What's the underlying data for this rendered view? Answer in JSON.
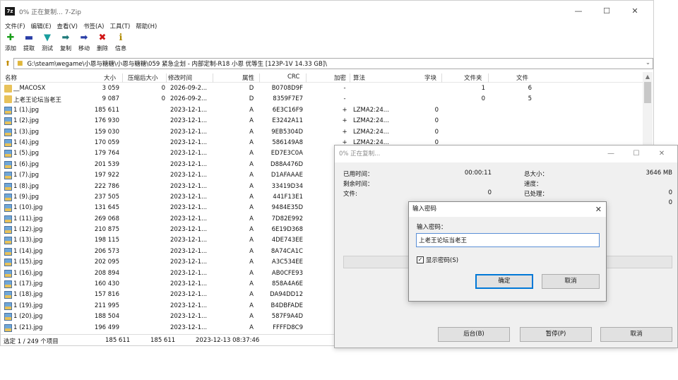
{
  "main_window": {
    "title": "0% 正在复制... 7-Zip",
    "app_icon_text": "7z",
    "controls": {
      "minimize": "—",
      "maximize": "☐",
      "close": "✕"
    }
  },
  "menu": [
    "文件(F)",
    "编辑(E)",
    "查看(V)",
    "书签(A)",
    "工具(T)",
    "帮助(H)"
  ],
  "toolbar": [
    {
      "label": "添加",
      "icon": "add-icon",
      "glyph": "✚",
      "color": "#1a9e1a"
    },
    {
      "label": "提取",
      "icon": "extract-icon",
      "glyph": "▬",
      "color": "#2a3ea6"
    },
    {
      "label": "测试",
      "icon": "test-icon",
      "glyph": "▼",
      "color": "#1a9e9e"
    },
    {
      "label": "复制",
      "icon": "copy-icon",
      "glyph": "➡",
      "color": "#1f7a7a"
    },
    {
      "label": "移动",
      "icon": "move-icon",
      "glyph": "➡",
      "color": "#2a3ea6"
    },
    {
      "label": "删除",
      "icon": "delete-icon",
      "glyph": "✖",
      "color": "#d01515"
    },
    {
      "label": "信息",
      "icon": "info-icon",
      "glyph": "ℹ",
      "color": "#b08a00"
    }
  ],
  "address": {
    "path": "G:\\steam\\wegame\\小恩与糖糖\\小恩与糖糖\\059 紧急企划 - 内部定制-R18 小恩 优等生 [123P-1V 14.33 GB]\\"
  },
  "columns": {
    "name": "名称",
    "size": "大小",
    "packed": "压缩后大小",
    "modified": "修改时间",
    "attributes": "属性",
    "crc": "CRC",
    "encrypted": "加密",
    "method": "算法",
    "block": "字块",
    "folders": "文件夹",
    "files": "文件"
  },
  "rows": [
    {
      "type": "folder",
      "name": "__MACOSX",
      "size": "3 059",
      "packed": "0",
      "modified": "2026-09-2...",
      "attr": "D",
      "crc": "B0708D9F",
      "enc": "-",
      "method": "",
      "block": "",
      "folders": "1",
      "files": "6"
    },
    {
      "type": "folder",
      "name": "上老王论坛当老王",
      "size": "9 087",
      "packed": "0",
      "modified": "2026-09-2...",
      "attr": "D",
      "crc": "8359F7E7",
      "enc": "-",
      "method": "",
      "block": "",
      "folders": "0",
      "files": "5"
    },
    {
      "type": "image",
      "name": "1 (1).jpg",
      "size": "185 611",
      "packed": "",
      "modified": "2023-12-1...",
      "attr": "A",
      "crc": "6E3C16F9",
      "enc": "+",
      "method": "LZMA2:24...",
      "block": "0",
      "folders": "",
      "files": ""
    },
    {
      "type": "image",
      "name": "1 (2).jpg",
      "size": "176 930",
      "packed": "",
      "modified": "2023-12-1...",
      "attr": "A",
      "crc": "E3242A11",
      "enc": "+",
      "method": "LZMA2:24...",
      "block": "0",
      "folders": "",
      "files": ""
    },
    {
      "type": "image",
      "name": "1 (3).jpg",
      "size": "159 030",
      "packed": "",
      "modified": "2023-12-1...",
      "attr": "A",
      "crc": "9EB5304D",
      "enc": "+",
      "method": "LZMA2:24...",
      "block": "0",
      "folders": "",
      "files": ""
    },
    {
      "type": "image",
      "name": "1 (4).jpg",
      "size": "170 059",
      "packed": "",
      "modified": "2023-12-1...",
      "attr": "A",
      "crc": "586149A8",
      "enc": "+",
      "method": "LZMA2:24...",
      "block": "0",
      "folders": "",
      "files": ""
    },
    {
      "type": "image",
      "name": "1 (5).jpg",
      "size": "179 764",
      "packed": "",
      "modified": "2023-12-1...",
      "attr": "A",
      "crc": "ED7E3C0A",
      "enc": "",
      "method": "",
      "block": "",
      "folders": "",
      "files": ""
    },
    {
      "type": "image",
      "name": "1 (6).jpg",
      "size": "201 539",
      "packed": "",
      "modified": "2023-12-1...",
      "attr": "A",
      "crc": "D88A476D",
      "enc": "",
      "method": "",
      "block": "",
      "folders": "",
      "files": ""
    },
    {
      "type": "image",
      "name": "1 (7).jpg",
      "size": "197 922",
      "packed": "",
      "modified": "2023-12-1...",
      "attr": "A",
      "crc": "D1AFAAAE",
      "enc": "",
      "method": "",
      "block": "",
      "folders": "",
      "files": ""
    },
    {
      "type": "image",
      "name": "1 (8).jpg",
      "size": "222 786",
      "packed": "",
      "modified": "2023-12-1...",
      "attr": "A",
      "crc": "33419D34",
      "enc": "",
      "method": "",
      "block": "",
      "folders": "",
      "files": ""
    },
    {
      "type": "image",
      "name": "1 (9).jpg",
      "size": "237 505",
      "packed": "",
      "modified": "2023-12-1...",
      "attr": "A",
      "crc": "441F13E1",
      "enc": "",
      "method": "",
      "block": "",
      "folders": "",
      "files": ""
    },
    {
      "type": "image",
      "name": "1 (10).jpg",
      "size": "131 645",
      "packed": "",
      "modified": "2023-12-1...",
      "attr": "A",
      "crc": "9484E35D",
      "enc": "",
      "method": "",
      "block": "",
      "folders": "",
      "files": ""
    },
    {
      "type": "image",
      "name": "1 (11).jpg",
      "size": "269 068",
      "packed": "",
      "modified": "2023-12-1...",
      "attr": "A",
      "crc": "7D82E992",
      "enc": "",
      "method": "",
      "block": "",
      "folders": "",
      "files": ""
    },
    {
      "type": "image",
      "name": "1 (12).jpg",
      "size": "210 875",
      "packed": "",
      "modified": "2023-12-1...",
      "attr": "A",
      "crc": "6E19D368",
      "enc": "",
      "method": "",
      "block": "",
      "folders": "",
      "files": ""
    },
    {
      "type": "image",
      "name": "1 (13).jpg",
      "size": "198 115",
      "packed": "",
      "modified": "2023-12-1...",
      "attr": "A",
      "crc": "4DE743EE",
      "enc": "",
      "method": "",
      "block": "",
      "folders": "",
      "files": ""
    },
    {
      "type": "image",
      "name": "1 (14).jpg",
      "size": "206 573",
      "packed": "",
      "modified": "2023-12-1...",
      "attr": "A",
      "crc": "8A74CA1C",
      "enc": "",
      "method": "",
      "block": "",
      "folders": "",
      "files": ""
    },
    {
      "type": "image",
      "name": "1 (15).jpg",
      "size": "202 095",
      "packed": "",
      "modified": "2023-12-1...",
      "attr": "A",
      "crc": "A3C534EE",
      "enc": "",
      "method": "",
      "block": "",
      "folders": "",
      "files": ""
    },
    {
      "type": "image",
      "name": "1 (16).jpg",
      "size": "208 894",
      "packed": "",
      "modified": "2023-12-1...",
      "attr": "A",
      "crc": "AB0CFE93",
      "enc": "",
      "method": "",
      "block": "",
      "folders": "",
      "files": ""
    },
    {
      "type": "image",
      "name": "1 (17).jpg",
      "size": "160 430",
      "packed": "",
      "modified": "2023-12-1...",
      "attr": "A",
      "crc": "858A4A6E",
      "enc": "",
      "method": "",
      "block": "",
      "folders": "",
      "files": ""
    },
    {
      "type": "image",
      "name": "1 (18).jpg",
      "size": "157 816",
      "packed": "",
      "modified": "2023-12-1...",
      "attr": "A",
      "crc": "DA94DD12",
      "enc": "",
      "method": "",
      "block": "",
      "folders": "",
      "files": ""
    },
    {
      "type": "image",
      "name": "1 (19).jpg",
      "size": "211 995",
      "packed": "",
      "modified": "2023-12-1...",
      "attr": "A",
      "crc": "B4DBFADE",
      "enc": "",
      "method": "",
      "block": "",
      "folders": "",
      "files": ""
    },
    {
      "type": "image",
      "name": "1 (20).jpg",
      "size": "188 504",
      "packed": "",
      "modified": "2023-12-1...",
      "attr": "A",
      "crc": "587F9A4D",
      "enc": "",
      "method": "",
      "block": "",
      "folders": "",
      "files": ""
    },
    {
      "type": "image",
      "name": "1 (21).jpg",
      "size": "196 499",
      "packed": "",
      "modified": "2023-12-1...",
      "attr": "A",
      "crc": "FFFFD8C9",
      "enc": "",
      "method": "",
      "block": "",
      "folders": "",
      "files": ""
    }
  ],
  "status": {
    "selection": "选定 1 / 249 个项目",
    "size": "185 611",
    "packed": "185 611",
    "modified": "2023-12-13 08:37:46"
  },
  "progress": {
    "title": "0% 正在复制...",
    "controls": {
      "minimize": "—",
      "maximize": "☐",
      "close": "✕"
    },
    "elapsed_label": "已用时间：",
    "elapsed_value": "00:00:11",
    "remaining_label": "剩余时间：",
    "files_label": "文件:",
    "files_value": "0",
    "total_label": "总大小：",
    "total_value": "3646 MB",
    "speed_label": "速度：",
    "processed_label": "已处理：",
    "processed_value": "0",
    "other_value": "0",
    "percent": 0,
    "buttons": {
      "background": "后台(B)",
      "pause": "暂停(P)",
      "cancel": "取消"
    }
  },
  "password_dialog": {
    "title": "输入密码",
    "close": "✕",
    "label": "输入密码：",
    "value": "上老王论坛当老王",
    "show_password": "显示密码(S)",
    "show_checked": "✓",
    "ok": "确定",
    "cancel": "取消"
  },
  "colors": {
    "accent": "#0078d7",
    "progress": "#06b025"
  }
}
